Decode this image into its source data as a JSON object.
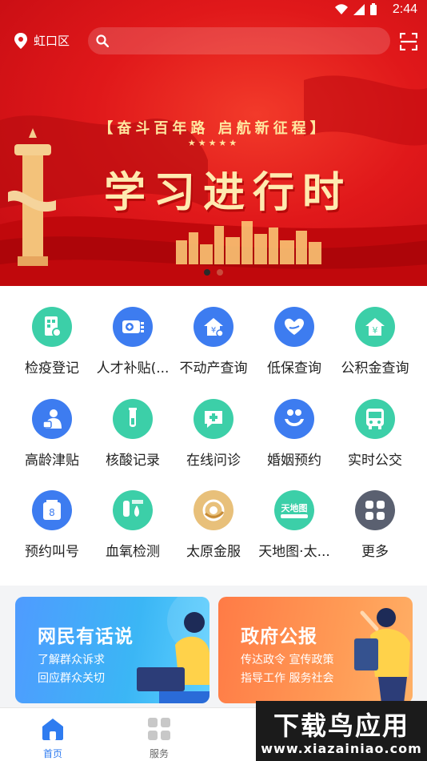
{
  "status_bar": {
    "time": "2:44"
  },
  "header": {
    "location": "虹口区",
    "search_placeholder": ""
  },
  "banner": {
    "slogan": "【奋斗百年路 启航新征程】",
    "stars": "★★★★★",
    "title": "学习进行时",
    "slide_count": 2,
    "active_slide": 1
  },
  "services": [
    {
      "label": "检疫登记",
      "icon": "document-scan-icon",
      "color": "#3ccfa8"
    },
    {
      "label": "人才补贴(...",
      "icon": "talent-subsidy-icon",
      "color": "#3d7cf0"
    },
    {
      "label": "不动产查询",
      "icon": "house-yuan-icon",
      "color": "#3d7cf0"
    },
    {
      "label": "低保查询",
      "icon": "heart-hand-icon",
      "color": "#3d7cf0"
    },
    {
      "label": "公积金查询",
      "icon": "house-fund-icon",
      "color": "#3ccfa8"
    },
    {
      "label": "高龄津贴",
      "icon": "elderly-icon",
      "color": "#3d7cf0"
    },
    {
      "label": "核酸记录",
      "icon": "test-tube-icon",
      "color": "#3ccfa8"
    },
    {
      "label": "在线问诊",
      "icon": "medical-chat-icon",
      "color": "#3ccfa8"
    },
    {
      "label": "婚姻预约",
      "icon": "marriage-icon",
      "color": "#3d7cf0"
    },
    {
      "label": "实时公交",
      "icon": "bus-icon",
      "color": "#3ccfa8"
    },
    {
      "label": "预约叫号",
      "icon": "queue-ticket-icon",
      "color": "#3d7cf0"
    },
    {
      "label": "血氧检测",
      "icon": "blood-oxygen-icon",
      "color": "#3ccfa8"
    },
    {
      "label": "太原金服",
      "icon": "taiyuan-finance-icon",
      "color": "#e8c07a"
    },
    {
      "label": "天地图·太...",
      "icon": "tianditu-icon",
      "color": "#3ccfa8"
    },
    {
      "label": "更多",
      "icon": "more-grid-icon",
      "color": "#5a6070"
    }
  ],
  "tianditu_logo_text": "天地图",
  "cards": [
    {
      "title": "网民有话说",
      "line1": "了解群众诉求",
      "line2": "回应群众关切"
    },
    {
      "title": "政府公报",
      "line1": "传达政令 宣传政策",
      "line2": "指导工作 服务社会"
    }
  ],
  "bottom_nav": [
    {
      "label": "首页",
      "icon": "home-icon",
      "active": true
    },
    {
      "label": "服务",
      "icon": "services-grid-icon",
      "active": false
    }
  ],
  "watermark": {
    "top": "下载鸟应用",
    "bottom": "www.xiazainiao.com"
  },
  "colors": {
    "banner_red": "#e0181a",
    "accent_blue": "#3d7cf0",
    "accent_green": "#3ccfa8"
  }
}
